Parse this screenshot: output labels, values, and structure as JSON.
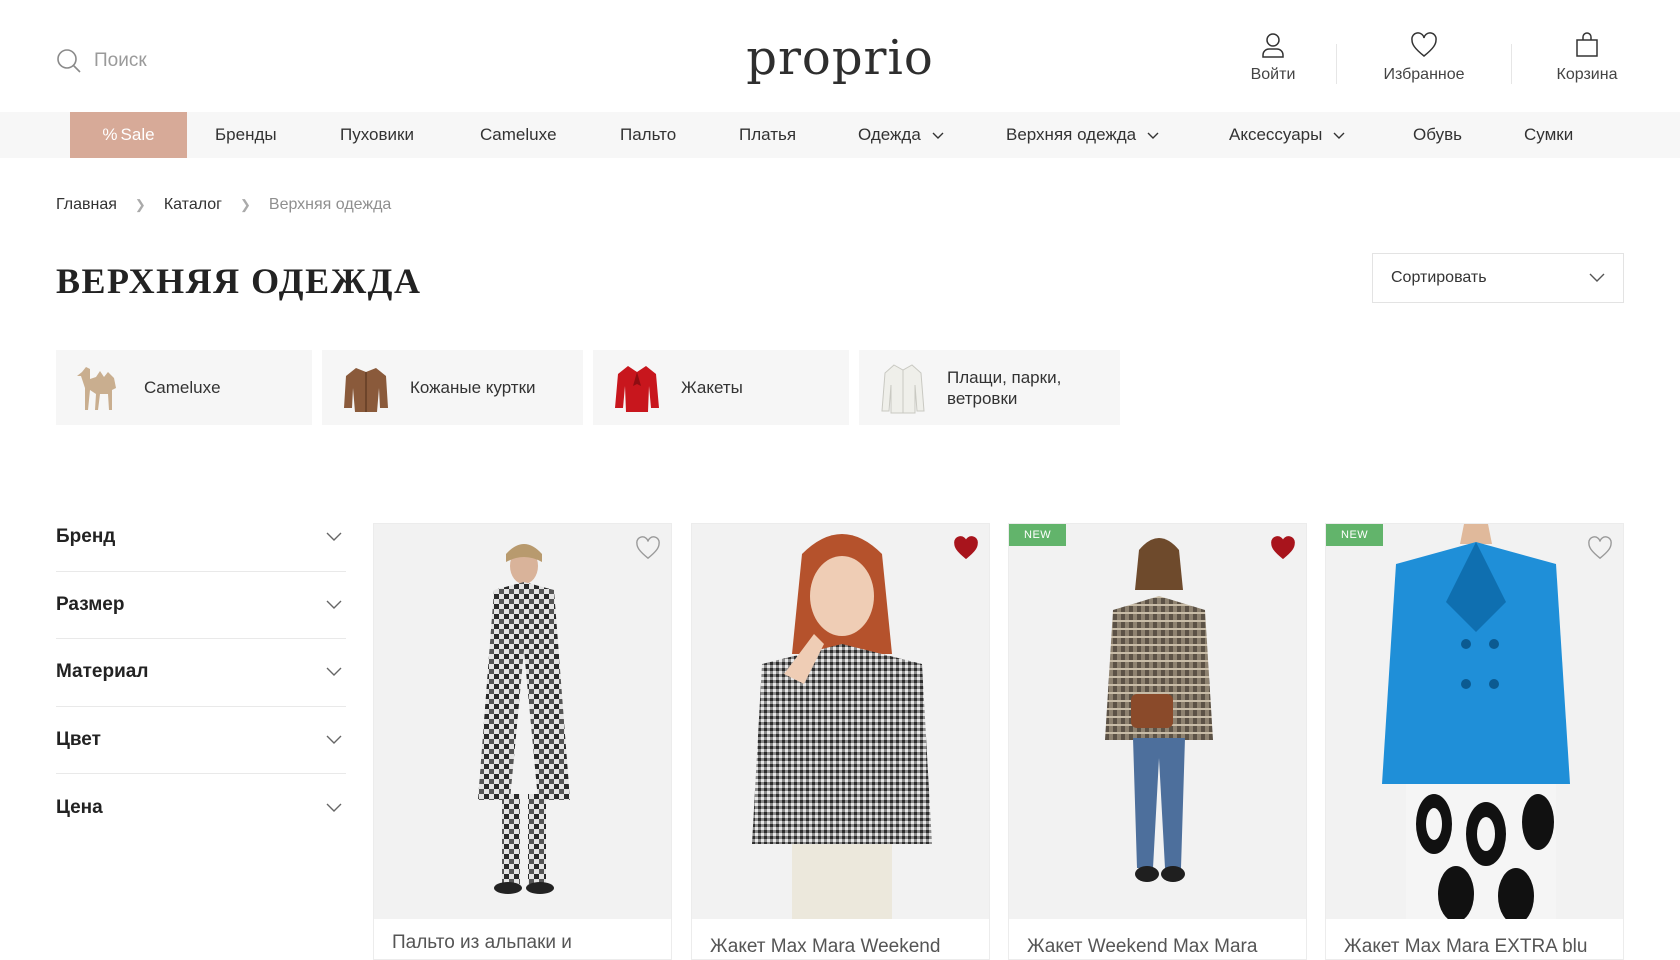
{
  "header": {
    "search_placeholder": "Поиск",
    "logo": "proprio",
    "login_label": "Войти",
    "favorites_label": "Избранное",
    "cart_label": "Корзина"
  },
  "nav": {
    "sale": "Sale",
    "items": [
      "Бренды",
      "Пуховики",
      "Cameluxe",
      "Пальто",
      "Платья",
      "Одежда",
      "Верхняя одежда",
      "Аксессуары",
      "Обувь",
      "Сумки"
    ]
  },
  "breadcrumb": {
    "home": "Главная",
    "catalog": "Каталог",
    "current": "Верхняя одежда"
  },
  "page_title": "ВЕРХНЯЯ ОДЕЖДА",
  "sort_label": "Сортировать",
  "categories": [
    "Cameluxe",
    "Кожаные куртки",
    "Жакеты",
    "Плащи, парки, ветровки"
  ],
  "filters": [
    "Бренд",
    "Размер",
    "Материал",
    "Цвет",
    "Цена"
  ],
  "products": [
    {
      "title": "Пальто из альпаки и",
      "badge": "",
      "favorited": false
    },
    {
      "title": "Жакет Max Mara Weekend",
      "badge": "",
      "favorited": true
    },
    {
      "title": "Жакет Weekend Max Mara",
      "badge": "NEW",
      "favorited": true
    },
    {
      "title": "Жакет Max Mara EXTRA blu",
      "badge": "NEW",
      "favorited": false
    }
  ],
  "colors": {
    "sale_bg": "#d7aa98",
    "badge": "#62b46b",
    "heart_active": "#a8141c"
  }
}
